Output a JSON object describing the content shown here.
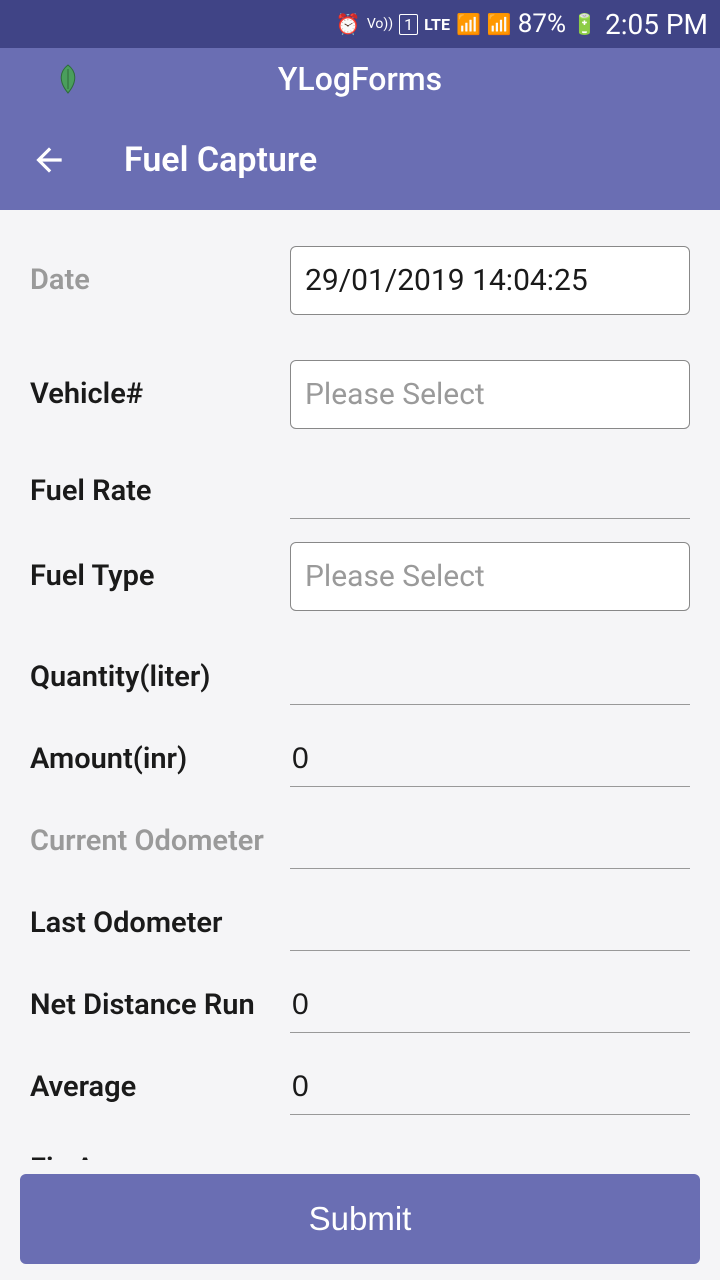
{
  "status": {
    "battery": "87%",
    "time": "2:05 PM",
    "lte": "LTE",
    "volte": "Vo))",
    "sim": "1"
  },
  "header": {
    "app_title": "YLogForms",
    "page_title": "Fuel Capture"
  },
  "form": {
    "date": {
      "label": "Date",
      "value": "29/01/2019 14:04:25"
    },
    "vehicle": {
      "label": "Vehicle#",
      "placeholder": "Please Select"
    },
    "fuel_rate": {
      "label": "Fuel Rate",
      "value": ""
    },
    "fuel_type": {
      "label": "Fuel Type",
      "placeholder": "Please Select"
    },
    "quantity": {
      "label": "Quantity(liter)",
      "value": ""
    },
    "amount": {
      "label": "Amount(inr)",
      "value": "0"
    },
    "current_odo": {
      "label": "Current Odometer",
      "value": ""
    },
    "last_odo": {
      "label": "Last Odometer",
      "value": ""
    },
    "net_distance": {
      "label": "Net Distance Run",
      "value": "0"
    },
    "average": {
      "label": "Average",
      "value": "0"
    },
    "fix_average": {
      "label": "Fix Average",
      "value": ""
    }
  },
  "submit_label": "Submit"
}
